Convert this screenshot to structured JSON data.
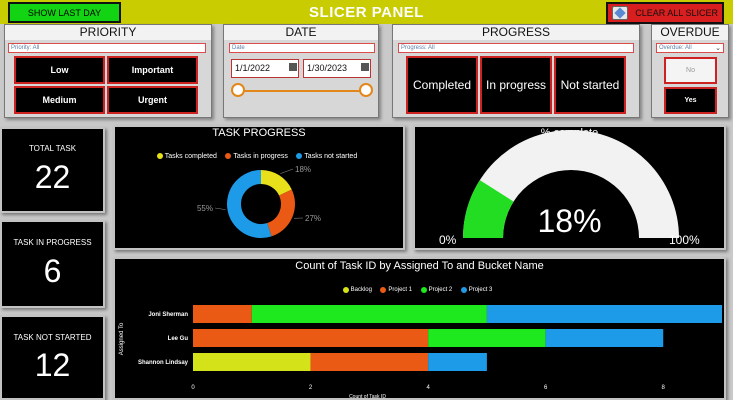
{
  "banner": {
    "title": "SLICER PANEL",
    "show_last_day": "SHOW LAST DAY",
    "clear_all": "CLEAR ALL SLICER",
    "color": "#c8cc00"
  },
  "priority": {
    "header": "PRIORITY",
    "dropdown": "Priority: All",
    "options": [
      "Low",
      "Important",
      "Medium",
      "Urgent"
    ]
  },
  "date": {
    "header": "DATE",
    "dropdown": "Date",
    "start": "1/1/2022",
    "end": "1/30/2023"
  },
  "progress": {
    "header": "PROGRESS",
    "dropdown": "Progress: All",
    "options": [
      "Completed",
      "In progress",
      "Not started"
    ]
  },
  "overdue": {
    "header": "OVERDUE",
    "dropdown": "Overdue: All",
    "options": [
      "No",
      "Yes"
    ]
  },
  "kpis": {
    "total_label": "TOTAL TASK",
    "total_value": "22",
    "in_progress_label": "TASK IN PROGRESS",
    "in_progress_value": "6",
    "not_started_label": "TASK NOT STARTED",
    "not_started_value": "12"
  },
  "task_progress": {
    "title": "TASK PROGRESS",
    "legend": [
      "Tasks completed",
      "Tasks in progress",
      "Tasks not started"
    ],
    "colors": [
      "#e8e01a",
      "#ea5a14",
      "#1e9be8"
    ],
    "values": [
      18,
      27,
      55
    ],
    "labels": [
      "18%",
      "27%",
      "55%"
    ]
  },
  "gauge": {
    "title": "% complete",
    "value": 18,
    "value_label": "18%",
    "min_label": "0%",
    "max_label": "100%",
    "fill_color": "#22dd22",
    "track_color": "#f2f2f2"
  },
  "chart_data": {
    "type": "bar",
    "orientation": "horizontal-stacked",
    "title": "Count of Task ID by Assigned To and Bucket Name",
    "xlabel": "Count of Task ID",
    "ylabel": "Assigned To",
    "xlim": [
      0,
      9
    ],
    "xticks": [
      "0",
      "2",
      "4",
      "6",
      "8"
    ],
    "categories": [
      "Joni Sherman",
      "Lee Gu",
      "Shannon Lindsay"
    ],
    "legend": [
      "Backlog",
      "Project 1",
      "Project 2",
      "Project 3"
    ],
    "colors": [
      "#d4e21a",
      "#ea5a14",
      "#1ee81e",
      "#1e9be8"
    ],
    "series": [
      {
        "name": "Backlog",
        "values": [
          0,
          0,
          2
        ]
      },
      {
        "name": "Project 1",
        "values": [
          1,
          4,
          2
        ]
      },
      {
        "name": "Project 2",
        "values": [
          4,
          2,
          0
        ]
      },
      {
        "name": "Project 3",
        "values": [
          4,
          2,
          1
        ]
      }
    ]
  }
}
